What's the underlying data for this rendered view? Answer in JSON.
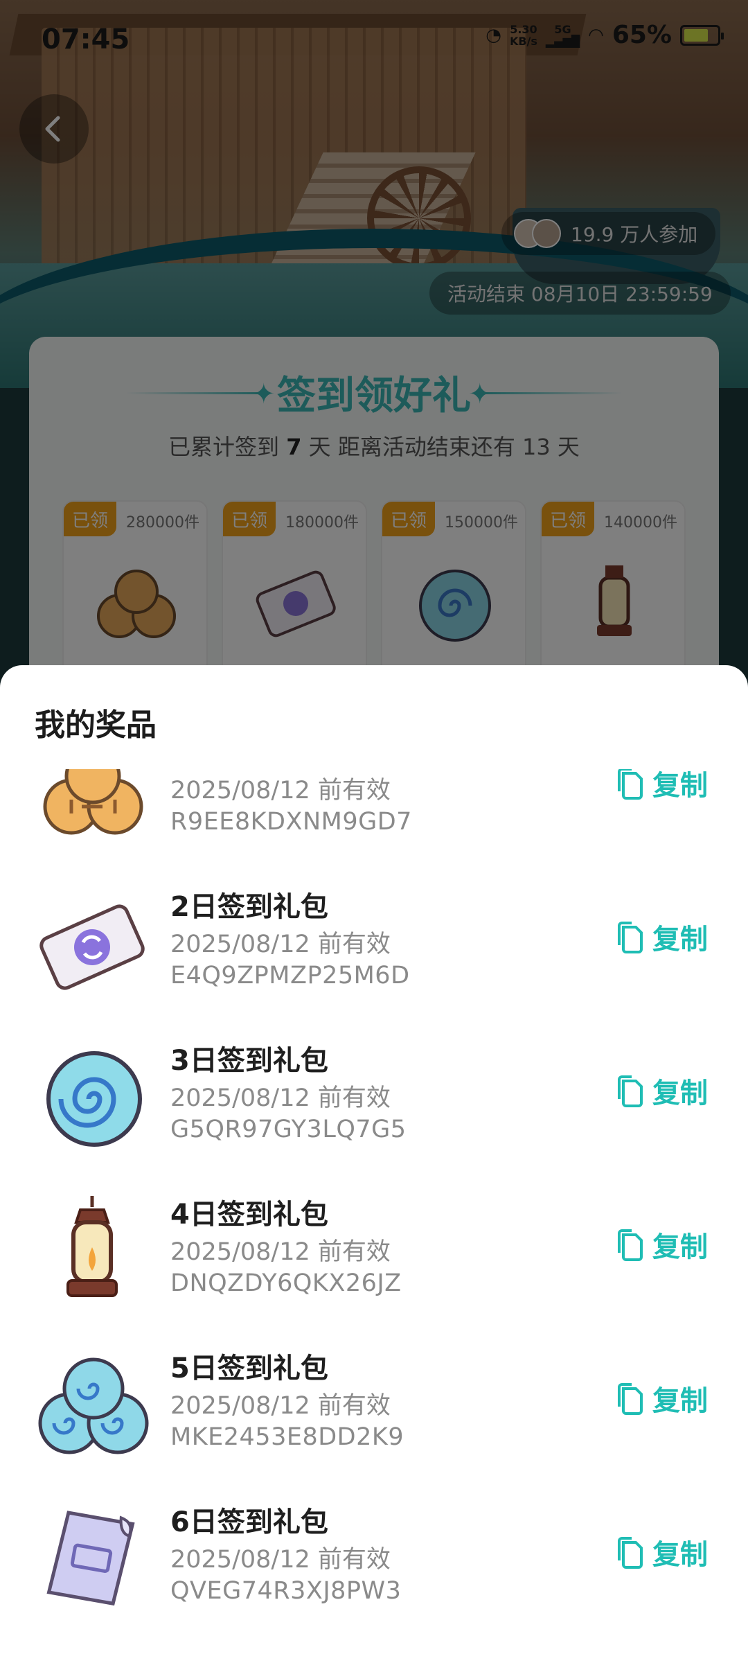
{
  "status_bar": {
    "time": "07:45",
    "net_speed_value": "5.30",
    "net_speed_unit": "KB/s",
    "network_type": "5G",
    "battery": "65%"
  },
  "hero": {
    "participants": "19.9 万人参加",
    "end_time": "活动结束 08月10日 23:59:59"
  },
  "signin": {
    "title": "签到领好礼",
    "subtitle_prefix": "已累计签到",
    "days_signed": "7",
    "subtitle_mid": "天 距离活动结束还有",
    "days_left": "13",
    "subtitle_suffix": "天",
    "tiles": [
      {
        "tag": "已领",
        "count": "280000件",
        "icon": "cookies-icon"
      },
      {
        "tag": "已领",
        "count": "180000件",
        "icon": "ticket-icon"
      },
      {
        "tag": "已领",
        "count": "150000件",
        "icon": "swirl-disc-icon"
      },
      {
        "tag": "已领",
        "count": "140000件",
        "icon": "lantern-icon"
      }
    ]
  },
  "sheet": {
    "title": "我的奖品",
    "copy_label": "复制",
    "items": [
      {
        "name": "",
        "valid": "2025/08/12 前有效",
        "code": "R9EE8KDXNM9GD7",
        "icon": "cookies-icon"
      },
      {
        "name": "2日签到礼包",
        "valid": "2025/08/12 前有效",
        "code": "E4Q9ZPMZP25M6D",
        "icon": "ticket-icon"
      },
      {
        "name": "3日签到礼包",
        "valid": "2025/08/12 前有效",
        "code": "G5QR97GY3LQ7G5",
        "icon": "swirl-disc-icon"
      },
      {
        "name": "4日签到礼包",
        "valid": "2025/08/12 前有效",
        "code": "DNQZDY6QKX26JZ",
        "icon": "lantern-icon"
      },
      {
        "name": "5日签到礼包",
        "valid": "2025/08/12 前有效",
        "code": "MKE2453E8DD2K9",
        "icon": "triple-swirl-icon"
      },
      {
        "name": "6日签到礼包",
        "valid": "2025/08/12 前有效",
        "code": "QVEG74R3XJ8PW3",
        "icon": "scroll-icon"
      }
    ]
  },
  "colors": {
    "accent": "#1fbdb4",
    "tag": "#f2a31a",
    "title_teal": "#3bb7b5"
  }
}
